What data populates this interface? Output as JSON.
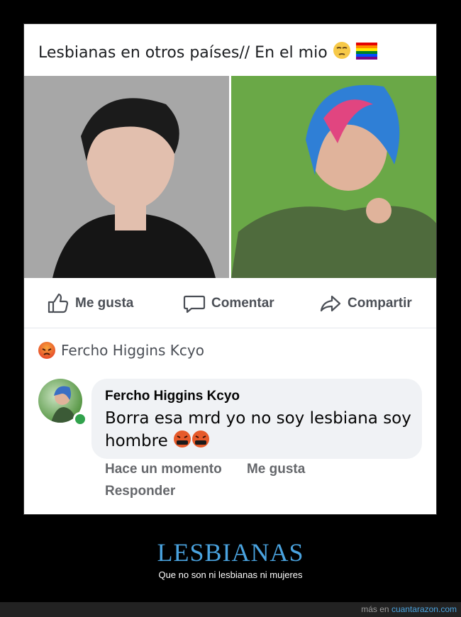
{
  "post": {
    "text": "Lesbianas en otros países// En el mio",
    "emoji_1": "unamused-face-emoji",
    "emoji_2": "rainbow-flag-emoji"
  },
  "photos": [
    {
      "name": "photo-left",
      "description_icon": "portrait-photo"
    },
    {
      "name": "photo-right",
      "description_icon": "portrait-photo"
    }
  ],
  "actions": {
    "like_label": "Me gusta",
    "comment_label": "Comentar",
    "share_label": "Compartir"
  },
  "reaction_summary": {
    "icon": "angry-reaction-icon",
    "name": "Fercho Higgins Kcyo"
  },
  "comment": {
    "author": "Fercho Higgins Kcyo",
    "text": "Borra esa mrd yo no soy lesbiana soy hombre",
    "emojis": [
      "swearing-face-emoji",
      "swearing-face-emoji"
    ],
    "time": "Hace un momento",
    "like_label": "Me gusta",
    "reply_label": "Responder"
  },
  "caption": {
    "title": "LESBIANAS",
    "subtitle": "Que no son ni lesbianas ni mujeres"
  },
  "footer": {
    "prefix": "más en",
    "link": "cuantarazon.com"
  },
  "colors": {
    "caption_blue": "#4aa3df",
    "fb_gray": "#65676b",
    "bubble": "#f0f2f5"
  }
}
